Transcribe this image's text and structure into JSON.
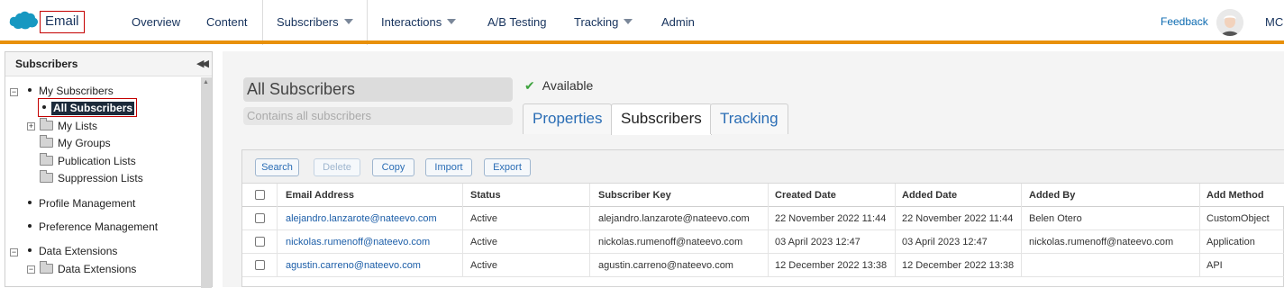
{
  "app": {
    "name": "Email"
  },
  "nav": {
    "items": [
      {
        "label": "Overview",
        "dropdown": false,
        "active": false
      },
      {
        "label": "Content",
        "dropdown": false,
        "active": false
      },
      {
        "label": "Subscribers",
        "dropdown": true,
        "active": true
      },
      {
        "label": "Interactions",
        "dropdown": true,
        "active": false
      },
      {
        "label": "A/B Testing",
        "dropdown": false,
        "active": false
      },
      {
        "label": "Tracking",
        "dropdown": true,
        "active": false
      },
      {
        "label": "Admin",
        "dropdown": false,
        "active": false
      }
    ],
    "feedback": "Feedback",
    "user_initials": "MC"
  },
  "sidebar": {
    "title": "Subscribers",
    "tree": [
      {
        "label": "My Subscribers",
        "kind": "bullet",
        "expander": "−"
      },
      {
        "label": "All Subscribers",
        "kind": "selected"
      },
      {
        "label": "My Lists",
        "kind": "folder",
        "expander": "+"
      },
      {
        "label": "My Groups",
        "kind": "folder"
      },
      {
        "label": "Publication Lists",
        "kind": "folder"
      },
      {
        "label": "Suppression Lists",
        "kind": "folder"
      },
      {
        "label": "Profile Management",
        "kind": "bullet"
      },
      {
        "label": "Preference Management",
        "kind": "bullet"
      },
      {
        "label": "Data Extensions",
        "kind": "bullet",
        "expander": "−"
      },
      {
        "label": "Data Extensions",
        "kind": "folder",
        "expander": "−"
      }
    ]
  },
  "main": {
    "title": "All Subscribers",
    "description": "Contains all subscribers",
    "status": "Available",
    "tabs": [
      {
        "label": "Properties",
        "active": false
      },
      {
        "label": "Subscribers",
        "active": true
      },
      {
        "label": "Tracking",
        "active": false
      }
    ],
    "toolbar": {
      "search": "Search",
      "delete": "Delete",
      "copy": "Copy",
      "import": "Import",
      "export": "Export"
    },
    "table": {
      "columns": [
        "Email Address",
        "Status",
        "Subscriber Key",
        "Created Date",
        "Added Date",
        "Added By",
        "Add Method"
      ],
      "rows": [
        [
          "alejandro.lanzarote@nateevo.com",
          "Active",
          "alejandro.lanzarote@nateevo.com",
          "22 November 2022 11:44",
          "22 November 2022 11:44",
          "Belen Otero",
          "CustomObject"
        ],
        [
          "nickolas.rumenoff@nateevo.com",
          "Active",
          "nickolas.rumenoff@nateevo.com",
          "03 April 2023 12:47",
          "03 April 2023 12:47",
          "nickolas.rumenoff@nateevo.com",
          "Application"
        ],
        [
          "agustin.carreno@nateevo.com",
          "Active",
          "agustin.carreno@nateevo.com",
          "12 December 2022 13:38",
          "12 December 2022 13:38",
          "",
          "API"
        ]
      ]
    }
  },
  "colors": {
    "accent": "#e8900a",
    "link": "#1c5ea8",
    "highlight_border": "#c40000"
  }
}
